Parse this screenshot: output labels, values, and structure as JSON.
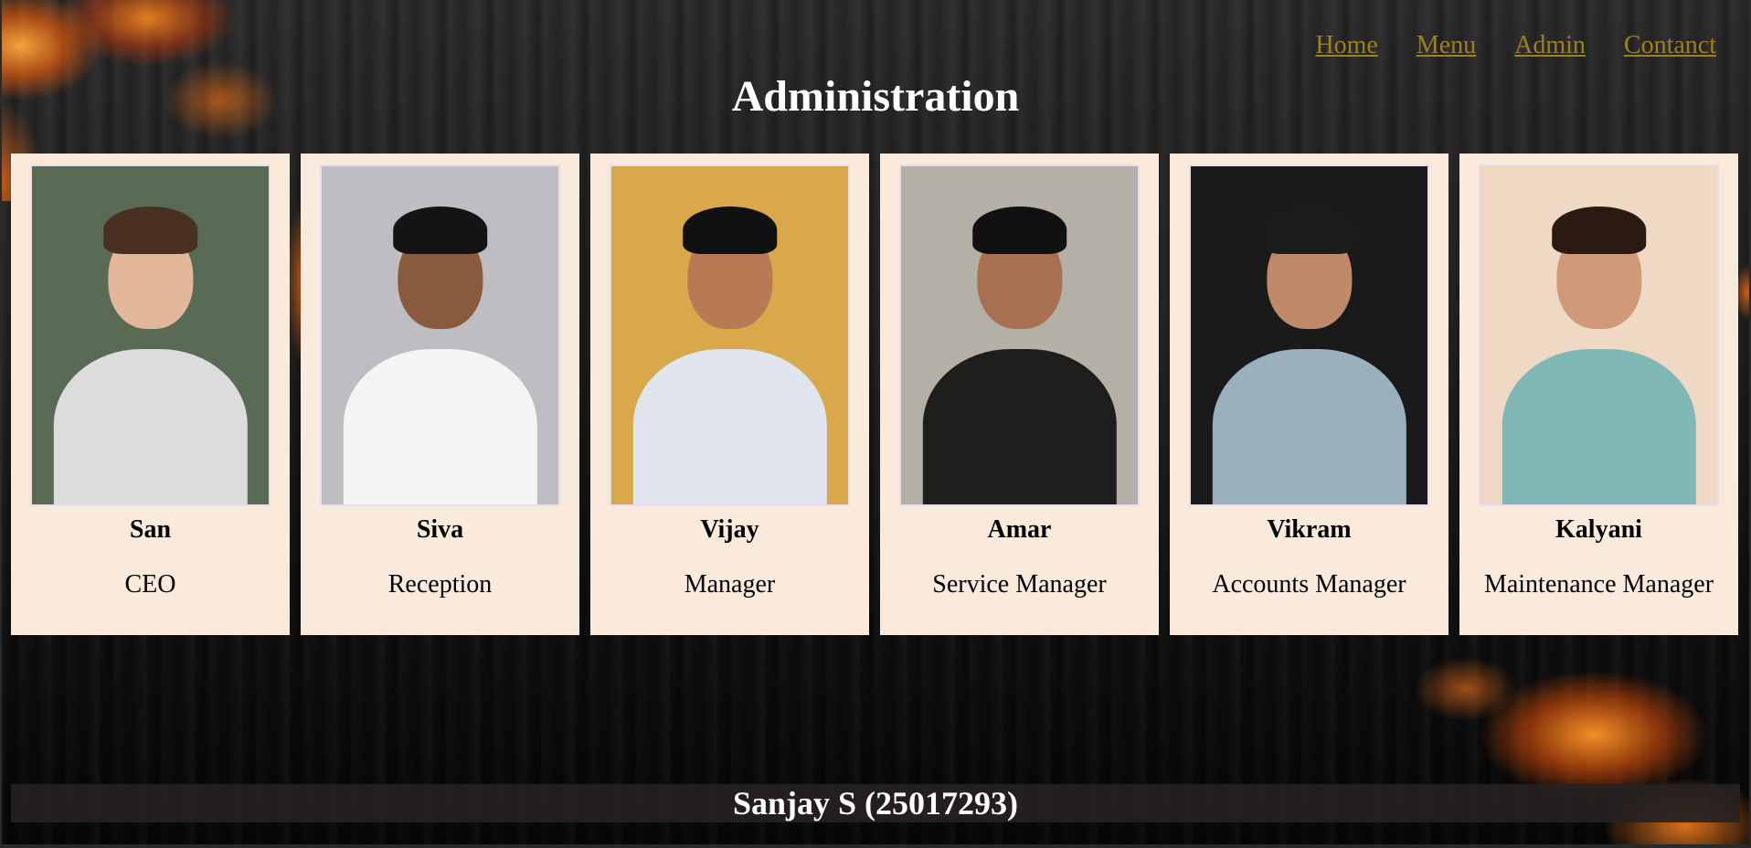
{
  "nav": {
    "items": [
      {
        "label": "Home"
      },
      {
        "label": "Menu"
      },
      {
        "label": "Admin"
      },
      {
        "label": "Contanct"
      }
    ],
    "link_color": "#a08018"
  },
  "page": {
    "title": "Administration"
  },
  "cards": [
    {
      "name": "San",
      "role": "CEO",
      "photo": {
        "bg": "#5a6b55",
        "skin": "#e3b89a",
        "hair": "#4a3020",
        "shirt": "#dcdcdc"
      }
    },
    {
      "name": "Siva",
      "role": "Reception",
      "photo": {
        "bg": "#bdbdc2",
        "skin": "#8a5a3c",
        "hair": "#141414",
        "shirt": "#f4f4f4"
      }
    },
    {
      "name": "Vijay",
      "role": "Manager",
      "photo": {
        "bg": "#d8a84a",
        "skin": "#b87a55",
        "hair": "#111111",
        "shirt": "#dfe4ee"
      }
    },
    {
      "name": "Amar",
      "role": "Service Manager",
      "photo": {
        "bg": "#b4b0a8",
        "skin": "#a87050",
        "hair": "#111111",
        "shirt": "#1e1e1c"
      }
    },
    {
      "name": "Vikram",
      "role": "Accounts Manager",
      "photo": {
        "bg": "#1a1a1a",
        "skin": "#c08a68",
        "hair": "#1c1c1c",
        "shirt": "#9ab0bc"
      }
    },
    {
      "name": "Kalyani",
      "role": "Maintenance Manager",
      "photo": {
        "bg": "#efd8c4",
        "skin": "#d09a78",
        "hair": "#2a1a12",
        "shirt": "#7fb8b4"
      }
    }
  ],
  "footer": {
    "text": "Sanjay S (25017293)"
  },
  "colors": {
    "card_bg": "#f9eadb",
    "footer_bg": "#262222"
  }
}
